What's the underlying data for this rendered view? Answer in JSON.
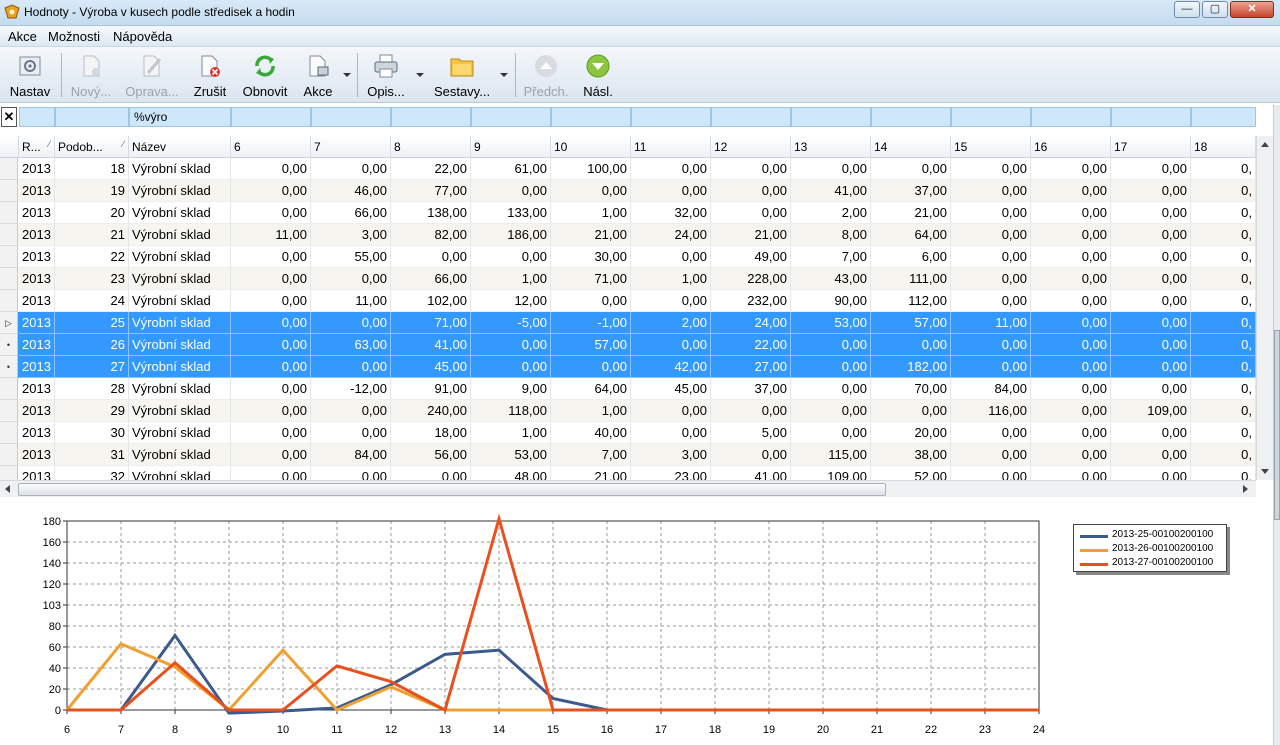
{
  "window": {
    "title": "Hodnoty - Výroba v kusech podle středisek a hodin",
    "buttons": {
      "minimize": "—",
      "maximize": "▢",
      "close": "✕"
    }
  },
  "menu": [
    "Akce",
    "Možnosti",
    "Nápověda"
  ],
  "toolbar": {
    "nastav": "Nastav",
    "novy": "Nový...",
    "oprava": "Oprava...",
    "zrusit": "Zrušit",
    "obnovit": "Obnovit",
    "akce": "Akce",
    "opis": "Opis...",
    "sestavy": "Sestavy...",
    "predch": "Předch.",
    "nasl": "Násl."
  },
  "filter": {
    "clear": "✕",
    "value": "%výro"
  },
  "grid": {
    "columns": [
      "R...",
      "Podob...",
      "Název",
      "6",
      "7",
      "8",
      "9",
      "10",
      "11",
      "12",
      "13",
      "14",
      "15",
      "16",
      "17",
      "18"
    ],
    "rows": [
      {
        "r": "2013",
        "p": "18",
        "n": "Výrobní sklad",
        "v": [
          "0,00",
          "0,00",
          "22,00",
          "61,00",
          "100,00",
          "0,00",
          "0,00",
          "0,00",
          "0,00",
          "0,00",
          "0,00",
          "0,00",
          "0,"
        ],
        "sel": false,
        "ind": ""
      },
      {
        "r": "2013",
        "p": "19",
        "n": "Výrobní sklad",
        "v": [
          "0,00",
          "46,00",
          "77,00",
          "0,00",
          "0,00",
          "0,00",
          "0,00",
          "41,00",
          "37,00",
          "0,00",
          "0,00",
          "0,00",
          "0,"
        ],
        "sel": false,
        "ind": ""
      },
      {
        "r": "2013",
        "p": "20",
        "n": "Výrobní sklad",
        "v": [
          "0,00",
          "66,00",
          "138,00",
          "133,00",
          "1,00",
          "32,00",
          "0,00",
          "2,00",
          "21,00",
          "0,00",
          "0,00",
          "0,00",
          "0,"
        ],
        "sel": false,
        "ind": ""
      },
      {
        "r": "2013",
        "p": "21",
        "n": "Výrobní sklad",
        "v": [
          "11,00",
          "3,00",
          "82,00",
          "186,00",
          "21,00",
          "24,00",
          "21,00",
          "8,00",
          "64,00",
          "0,00",
          "0,00",
          "0,00",
          "0,"
        ],
        "sel": false,
        "ind": ""
      },
      {
        "r": "2013",
        "p": "22",
        "n": "Výrobní sklad",
        "v": [
          "0,00",
          "55,00",
          "0,00",
          "0,00",
          "30,00",
          "0,00",
          "49,00",
          "7,00",
          "6,00",
          "0,00",
          "0,00",
          "0,00",
          "0,"
        ],
        "sel": false,
        "ind": ""
      },
      {
        "r": "2013",
        "p": "23",
        "n": "Výrobní sklad",
        "v": [
          "0,00",
          "0,00",
          "66,00",
          "1,00",
          "71,00",
          "1,00",
          "228,00",
          "43,00",
          "111,00",
          "0,00",
          "0,00",
          "0,00",
          "0,"
        ],
        "sel": false,
        "ind": ""
      },
      {
        "r": "2013",
        "p": "24",
        "n": "Výrobní sklad",
        "v": [
          "0,00",
          "11,00",
          "102,00",
          "12,00",
          "0,00",
          "0,00",
          "232,00",
          "90,00",
          "112,00",
          "0,00",
          "0,00",
          "0,00",
          "0,"
        ],
        "sel": false,
        "ind": ""
      },
      {
        "r": "2013",
        "p": "25",
        "n": "Výrobní sklad",
        "v": [
          "0,00",
          "0,00",
          "71,00",
          "-5,00",
          "-1,00",
          "2,00",
          "24,00",
          "53,00",
          "57,00",
          "11,00",
          "0,00",
          "0,00",
          "0,"
        ],
        "sel": true,
        "ind": "▷"
      },
      {
        "r": "2013",
        "p": "26",
        "n": "Výrobní sklad",
        "v": [
          "0,00",
          "63,00",
          "41,00",
          "0,00",
          "57,00",
          "0,00",
          "22,00",
          "0,00",
          "0,00",
          "0,00",
          "0,00",
          "0,00",
          "0,"
        ],
        "sel": true,
        "ind": "•"
      },
      {
        "r": "2013",
        "p": "27",
        "n": "Výrobní sklad",
        "v": [
          "0,00",
          "0,00",
          "45,00",
          "0,00",
          "0,00",
          "42,00",
          "27,00",
          "0,00",
          "182,00",
          "0,00",
          "0,00",
          "0,00",
          "0,"
        ],
        "sel": true,
        "ind": "•"
      },
      {
        "r": "2013",
        "p": "28",
        "n": "Výrobní sklad",
        "v": [
          "0,00",
          "-12,00",
          "91,00",
          "9,00",
          "64,00",
          "45,00",
          "37,00",
          "0,00",
          "70,00",
          "84,00",
          "0,00",
          "0,00",
          "0,"
        ],
        "sel": false,
        "ind": ""
      },
      {
        "r": "2013",
        "p": "29",
        "n": "Výrobní sklad",
        "v": [
          "0,00",
          "0,00",
          "240,00",
          "118,00",
          "1,00",
          "0,00",
          "0,00",
          "0,00",
          "0,00",
          "116,00",
          "0,00",
          "109,00",
          "0,"
        ],
        "sel": false,
        "ind": ""
      },
      {
        "r": "2013",
        "p": "30",
        "n": "Výrobní sklad",
        "v": [
          "0,00",
          "0,00",
          "18,00",
          "1,00",
          "40,00",
          "0,00",
          "5,00",
          "0,00",
          "20,00",
          "0,00",
          "0,00",
          "0,00",
          "0,"
        ],
        "sel": false,
        "ind": ""
      },
      {
        "r": "2013",
        "p": "31",
        "n": "Výrobní sklad",
        "v": [
          "0,00",
          "84,00",
          "56,00",
          "53,00",
          "7,00",
          "3,00",
          "0,00",
          "115,00",
          "38,00",
          "0,00",
          "0,00",
          "0,00",
          "0,"
        ],
        "sel": false,
        "ind": ""
      },
      {
        "r": "2013",
        "p": "32",
        "n": "Výrobní sklad",
        "v": [
          "0,00",
          "0,00",
          "0,00",
          "48,00",
          "21,00",
          "23,00",
          "41,00",
          "109,00",
          "52,00",
          "0,00",
          "0,00",
          "0,00",
          "0,"
        ],
        "sel": false,
        "ind": ""
      }
    ]
  },
  "colors": {
    "selection": "#3399ff",
    "series25": "#3c5a8c",
    "series26": "#f0a030",
    "series27": "#e8501e"
  },
  "chart_data": {
    "type": "line",
    "x": [
      6,
      7,
      8,
      9,
      10,
      11,
      12,
      13,
      14,
      15,
      16,
      17,
      18,
      19,
      20,
      21,
      22,
      23,
      24
    ],
    "xlim": [
      6,
      24
    ],
    "ylim": [
      0,
      180
    ],
    "yticks": [
      0,
      20,
      40,
      60,
      80,
      103,
      120,
      140,
      160,
      180
    ],
    "grid": true,
    "legend_position": "top-right",
    "series": [
      {
        "name": "2013-25-00100200100",
        "color": "#3c5a8c",
        "values": [
          0,
          0,
          71,
          -5,
          -1,
          2,
          24,
          53,
          57,
          11,
          0,
          0,
          0,
          0,
          0,
          0,
          0,
          0,
          0
        ]
      },
      {
        "name": "2013-26-00100200100",
        "color": "#f0a030",
        "values": [
          0,
          63,
          41,
          0,
          57,
          0,
          22,
          0,
          0,
          0,
          0,
          0,
          0,
          0,
          0,
          0,
          0,
          0,
          0
        ]
      },
      {
        "name": "2013-27-00100200100",
        "color": "#e8501e",
        "values": [
          0,
          0,
          45,
          0,
          0,
          42,
          27,
          0,
          182,
          0,
          0,
          0,
          0,
          0,
          0,
          0,
          0,
          0,
          0
        ]
      }
    ]
  }
}
